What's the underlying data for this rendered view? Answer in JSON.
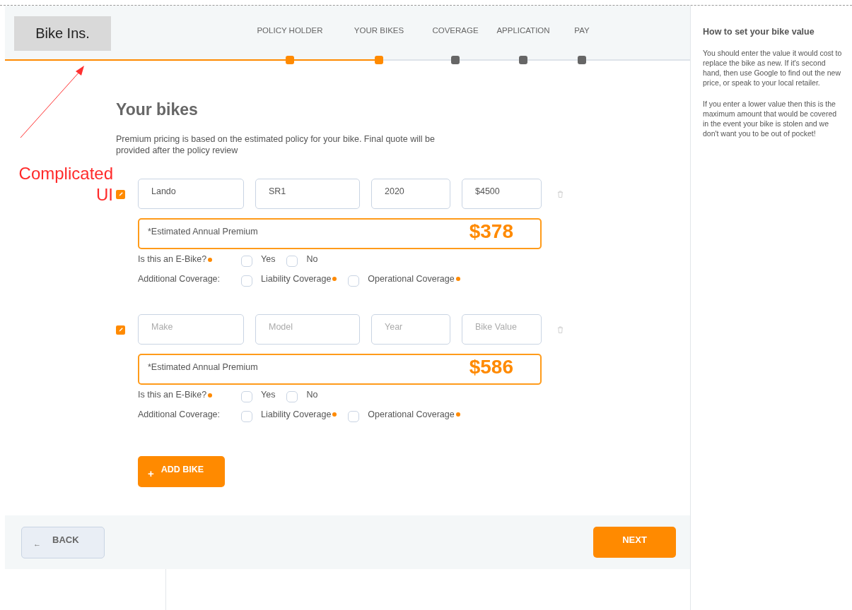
{
  "logo": "Bike Ins.",
  "steps": [
    {
      "label": "POLICY HOLDER",
      "done": true
    },
    {
      "label": "YOUR BIKES",
      "done": true
    },
    {
      "label": "COVERAGE",
      "done": false
    },
    {
      "label": "APPLICATION",
      "done": false
    },
    {
      "label": "PAY",
      "done": false
    }
  ],
  "annotation": {
    "lines": [
      "Complicated",
      "UI"
    ]
  },
  "heading": "Your bikes",
  "intro": "Premium pricing is based on the estimated policy for your bike. Final quote will be provided after the policy review",
  "bikes": [
    {
      "fields": [
        {
          "value": "Lando"
        },
        {
          "value": "SR1"
        },
        {
          "value": "2020"
        },
        {
          "value": "$4500"
        }
      ],
      "premium": {
        "label": "*Estimated Annual Premium",
        "amount": "$378"
      },
      "ebike": {
        "label": "Is this an E-Bike?",
        "options": [
          {
            "label": "Yes",
            "checked": false,
            "info": false
          },
          {
            "label": "No",
            "checked": false,
            "info": false
          }
        ]
      },
      "coverage": {
        "label": "Additional Coverage:",
        "options": [
          {
            "label": "Liability Coverage",
            "checked": false,
            "info": true
          },
          {
            "label": "Operational Coverage",
            "checked": false,
            "info": true
          }
        ]
      }
    },
    {
      "fields": [
        {
          "placeholder": "Make"
        },
        {
          "placeholder": "Model"
        },
        {
          "placeholder": "Year"
        },
        {
          "placeholder": "Bike Value"
        }
      ],
      "premium": {
        "label": "*Estimated Annual Premium",
        "amount": "$586"
      },
      "ebike": {
        "label": "Is this an E-Bike?",
        "options": [
          {
            "label": "Yes",
            "checked": false,
            "info": false
          },
          {
            "label": "No",
            "checked": false,
            "info": false
          }
        ]
      },
      "coverage": {
        "label": "Additional Coverage:",
        "options": [
          {
            "label": "Liability Coverage",
            "checked": false,
            "info": true
          },
          {
            "label": "Operational Coverage",
            "checked": false,
            "info": true
          }
        ]
      }
    }
  ],
  "add_icon": "+",
  "add_button": "ADD BIKE",
  "back_icon": "←",
  "back_button": "BACK",
  "next_button": "NEXT",
  "help": {
    "title": "How to set your bike value",
    "paragraphs": [
      "You should enter the value it would cost to replace the bike as new. If it's second hand, then use Google to find out the new price, or speak to your local retailer.",
      "If you enter a lower value then this is the maximum amount that would be covered in the event your bike is stolen and we don't want you to be out of pocket!"
    ]
  }
}
